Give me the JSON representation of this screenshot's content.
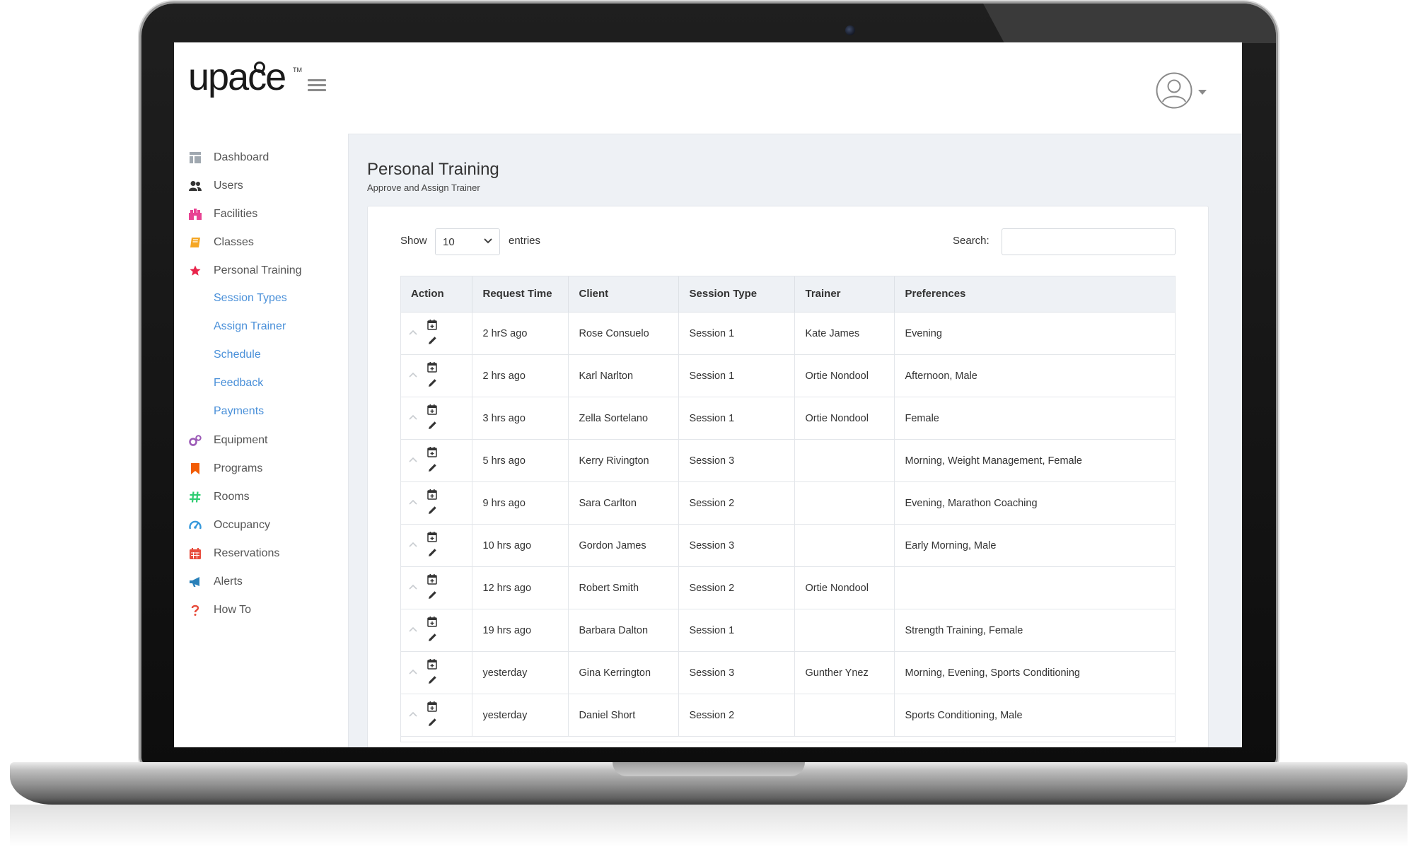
{
  "brand": {
    "logo_text": "upace",
    "tm": "TM"
  },
  "nav": {
    "items": [
      {
        "label": "Dashboard",
        "icon": "dashboard-icon",
        "color": "#a0a8b0"
      },
      {
        "label": "Users",
        "icon": "users-icon",
        "color": "#333333"
      },
      {
        "label": "Facilities",
        "icon": "facilities-icon",
        "color": "#e84393"
      },
      {
        "label": "Classes",
        "icon": "classes-icon",
        "color": "#f5a623"
      },
      {
        "label": "Personal Training",
        "icon": "star-icon",
        "color": "#e8234a"
      },
      {
        "label": "Equipment",
        "icon": "equipment-icon",
        "color": "#9b59b6"
      },
      {
        "label": "Programs",
        "icon": "bookmark-icon",
        "color": "#f25c05"
      },
      {
        "label": "Rooms",
        "icon": "hash-icon",
        "color": "#2ecc71"
      },
      {
        "label": "Occupancy",
        "icon": "gauge-icon",
        "color": "#3498db"
      },
      {
        "label": "Reservations",
        "icon": "calendar-icon",
        "color": "#e74c3c"
      },
      {
        "label": "Alerts",
        "icon": "megaphone-icon",
        "color": "#2980b9"
      },
      {
        "label": "How To",
        "icon": "question-icon",
        "color": "#e74c3c"
      }
    ],
    "sub_items": [
      "Session Types",
      "Assign Trainer",
      "Schedule",
      "Feedback",
      "Payments"
    ],
    "sub_color": "#4a90d9"
  },
  "page": {
    "title": "Personal Training",
    "subtitle": "Approve and Assign Trainer"
  },
  "controls": {
    "show_label": "Show",
    "entries_value": "10",
    "entries_label": "entries",
    "search_label": "Search:",
    "search_value": ""
  },
  "table": {
    "columns": [
      "Action",
      "Request Time",
      "Client",
      "Session Type",
      "Trainer",
      "Preferences"
    ],
    "rows": [
      {
        "time": "2 hrS ago",
        "client": "Rose Consuelo",
        "session": "Session 1",
        "trainer": "Kate James",
        "prefs": "Evening"
      },
      {
        "time": "2 hrs ago",
        "client": "Karl Narlton",
        "session": "Session 1",
        "trainer": "Ortie Nondool",
        "prefs": "Afternoon, Male"
      },
      {
        "time": "3 hrs ago",
        "client": "Zella Sortelano",
        "session": "Session 1",
        "trainer": "Ortie Nondool",
        "prefs": "Female"
      },
      {
        "time": "5 hrs ago",
        "client": "Kerry Rivington",
        "session": "Session 3",
        "trainer": "",
        "prefs": "Morning, Weight Management, Female"
      },
      {
        "time": "9 hrs ago",
        "client": "Sara Carlton",
        "session": "Session 2",
        "trainer": "",
        "prefs": "Evening, Marathon Coaching"
      },
      {
        "time": "10 hrs ago",
        "client": "Gordon James",
        "session": "Session 3",
        "trainer": "",
        "prefs": "Early Morning, Male"
      },
      {
        "time": "12 hrs ago",
        "client": "Robert Smith",
        "session": "Session 2",
        "trainer": "Ortie Nondool",
        "prefs": ""
      },
      {
        "time": "19 hrs ago",
        "client": "Barbara Dalton",
        "session": "Session 1",
        "trainer": "",
        "prefs": "Strength Training, Female"
      },
      {
        "time": "yesterday",
        "client": "Gina Kerrington",
        "session": "Session 3",
        "trainer": "Gunther Ynez",
        "prefs": "Morning, Evening, Sports Conditioning"
      },
      {
        "time": "yesterday",
        "client": "Daniel Short",
        "session": "Session 2",
        "trainer": "",
        "prefs": "Sports Conditioning, Male"
      }
    ]
  }
}
